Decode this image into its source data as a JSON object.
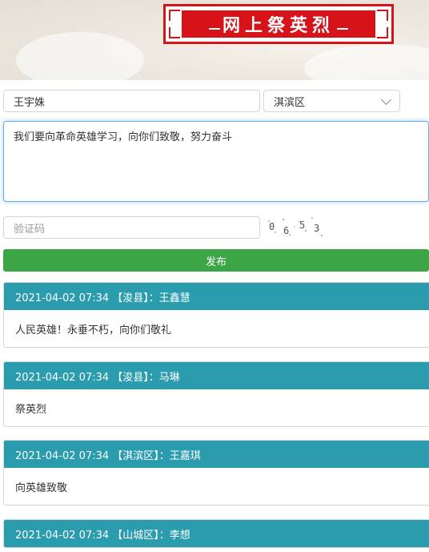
{
  "banner": {
    "title": "网上祭英烈"
  },
  "form": {
    "name_value": "王宇姝",
    "district_value": "淇滨区",
    "message_value": "我们要向革命英雄学习，向你们致敬，努力奋斗",
    "captcha_placeholder": "验证码",
    "captcha_chars": [
      "0",
      "6",
      "5",
      "3"
    ],
    "submit_label": "发布"
  },
  "messages": [
    {
      "header": "2021-04-02 07:34 【浚县】：王鑫慧",
      "body": "人民英雄！永垂不朽，向你们敬礼"
    },
    {
      "header": "2021-04-02 07:34 【浚县】：马琳",
      "body": "祭英烈"
    },
    {
      "header": "2021-04-02 07:34 【淇滨区】：王嘉琪",
      "body": "向英雄致敬"
    },
    {
      "header": "2021-04-02 07:34 【山城区】：李想",
      "body": ""
    }
  ]
}
